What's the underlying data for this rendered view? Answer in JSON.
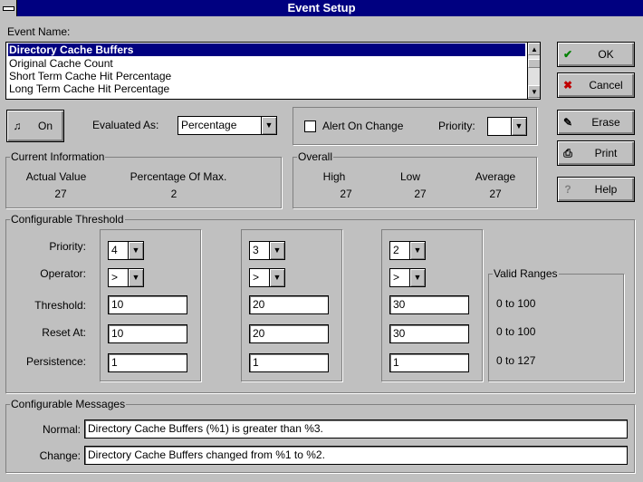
{
  "window": {
    "title": "Event Setup"
  },
  "event_name": {
    "label": "Event Name:",
    "items": [
      "Directory Cache Buffers",
      "Original Cache Count",
      "Short Term Cache Hit Percentage",
      "Long Term Cache Hit Percentage"
    ],
    "selected_index": 0
  },
  "buttons": {
    "ok": "OK",
    "cancel": "Cancel",
    "erase": "Erase",
    "print": "Print",
    "help": "Help",
    "on": "On"
  },
  "evaluated_as": {
    "label": "Evaluated As:",
    "value": "Percentage"
  },
  "alert": {
    "label": "Alert On Change",
    "checked": false
  },
  "priority": {
    "label": "Priority:",
    "value": ""
  },
  "current_information": {
    "title": "Current Information",
    "actual_value_label": "Actual Value",
    "actual_value": "27",
    "pct_max_label": "Percentage Of Max.",
    "pct_max": "2"
  },
  "overall": {
    "title": "Overall",
    "high_label": "High",
    "high": "27",
    "low_label": "Low",
    "low": "27",
    "average_label": "Average",
    "average": "27"
  },
  "thresholds": {
    "title": "Configurable Threshold",
    "row_labels": [
      "Priority:",
      "Operator:",
      "Threshold:",
      "Reset At:",
      "Persistence:"
    ],
    "columns": [
      {
        "priority": "4",
        "operator": ">",
        "threshold": "10",
        "reset": "10",
        "persistence": "1"
      },
      {
        "priority": "3",
        "operator": ">",
        "threshold": "20",
        "reset": "20",
        "persistence": "1"
      },
      {
        "priority": "2",
        "operator": ">",
        "threshold": "30",
        "reset": "30",
        "persistence": "1"
      }
    ],
    "valid_ranges": {
      "title": "Valid Ranges",
      "values": [
        "0 to 100",
        "0 to 100",
        "0 to 127"
      ]
    }
  },
  "messages": {
    "title": "Configurable Messages",
    "normal_label": "Normal:",
    "normal": "Directory Cache Buffers (%1) is greater than %3.",
    "change_label": "Change:",
    "change": "Directory Cache Buffers changed from %1 to %2."
  },
  "icons": {
    "ok": "check-icon",
    "cancel": "x-icon",
    "erase": "eraser-icon",
    "print": "printer-icon",
    "help": "question-icon",
    "on": "bell-icon"
  },
  "colors": {
    "title_bar": "#000080",
    "ok_icon": "#008000",
    "cancel_icon": "#c00000",
    "help_icon": "#808080"
  }
}
